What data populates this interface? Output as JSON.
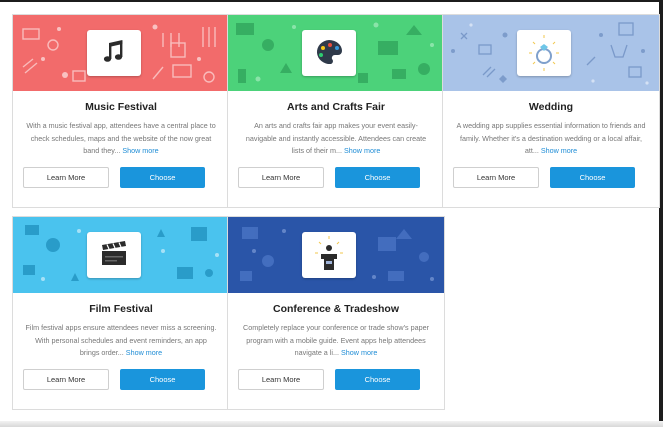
{
  "cards": [
    {
      "title": "Music Festival",
      "desc": "With a music festival app, attendees have a central place to check schedules, maps and the website of the now great band they...",
      "more": "Show more",
      "learn": "Learn More",
      "choose": "Choose",
      "banner_color": "#f26b6b",
      "icon": "music-note-icon"
    },
    {
      "title": "Arts and Crafts Fair",
      "desc": "An arts and crafts fair app makes your event easily-navigable and instantly accessible. Attendees can create lists of their m...",
      "more": "Show more",
      "learn": "Learn More",
      "choose": "Choose",
      "banner_color": "#4cd27a",
      "icon": "palette-icon"
    },
    {
      "title": "Wedding",
      "desc": "A wedding app supplies essential information to friends and family. Whether it's a destination wedding or a local affair, att...",
      "more": "Show more",
      "learn": "Learn More",
      "choose": "Choose",
      "banner_color": "#a9c3e8",
      "icon": "ring-icon"
    },
    {
      "title": "Film Festival",
      "desc": "Film festival apps ensure attendees never miss a screening. With personal schedules and event reminders, an app brings order...",
      "more": "Show more",
      "learn": "Learn More",
      "choose": "Choose",
      "banner_color": "#4ac3ee",
      "icon": "clapperboard-icon"
    },
    {
      "title": "Conference & Tradeshow",
      "desc": "Completely replace your conference or trade show's paper program with a mobile guide. Event apps help attendees navigate a li...",
      "more": "Show more",
      "learn": "Learn More",
      "choose": "Choose",
      "banner_color": "#2a55a8",
      "icon": "podium-icon"
    }
  ],
  "colors": {
    "accent": "#1a95dc",
    "link": "#1f8dd6"
  }
}
